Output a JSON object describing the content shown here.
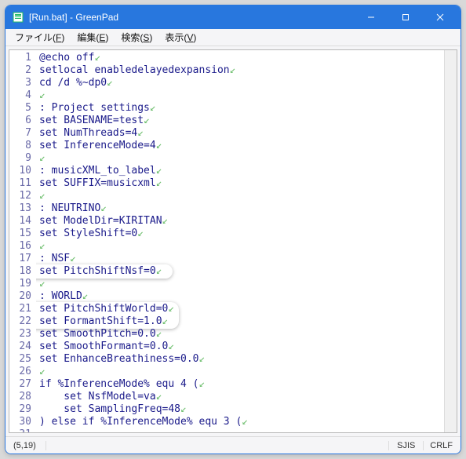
{
  "window": {
    "title": "[Run.bat] - GreenPad"
  },
  "menu": {
    "file": "ファイル(F)",
    "edit": "編集(E)",
    "search": "検索(S)",
    "view": "表示(V)"
  },
  "status": {
    "pos": "(5,19)",
    "encoding": "SJIS",
    "eol": "CRLF"
  },
  "code": {
    "lines": [
      "@echo off",
      "setlocal enabledelayedexpansion",
      "cd /d %~dp0",
      "",
      ": Project settings",
      "set BASENAME=test",
      "set NumThreads=4",
      "set InferenceMode=4",
      "",
      ": musicXML_to_label",
      "set SUFFIX=musicxml",
      "",
      ": NEUTRINO",
      "set ModelDir=KIRITAN",
      "set StyleShift=0",
      "",
      ": NSF",
      "set PitchShiftNsf=0",
      "",
      ": WORLD",
      "set PitchShiftWorld=0",
      "set FormantShift=1.0",
      "set SmoothPitch=0.0",
      "set SmoothFormant=0.0",
      "set EnhanceBreathiness=0.0",
      "",
      "if %InferenceMode% equ 4 (",
      "    set NsfModel=va",
      "    set SamplingFreq=48",
      ") else if %InferenceMode% equ 3 ("
    ]
  },
  "icons": {
    "ret_mark": "↙"
  }
}
